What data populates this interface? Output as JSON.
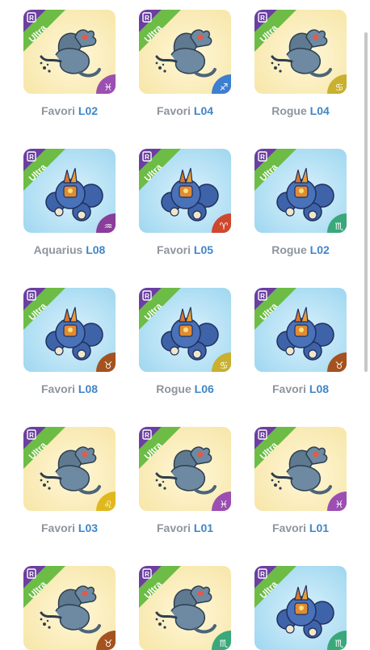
{
  "badge": "R",
  "ribbon": "Ultra",
  "colors": {
    "ribbon_green": "#6cbc46",
    "corner_purple": "#6b3fa0",
    "bg_yellow": "#f7e6a8",
    "bg_blue": "#9fd7f0",
    "label_gray": "#8d959e",
    "level_blue": "#3f86c8"
  },
  "cards": [
    {
      "name": "Favori",
      "level": "L02",
      "creature": "dragon",
      "bg": "yellow",
      "sign": "pisces-icon",
      "sign_glyph": "♓",
      "sign_color": "#9b4fb2"
    },
    {
      "name": "Favori",
      "level": "L04",
      "creature": "dragon",
      "bg": "yellow",
      "sign": "sagittarius-icon",
      "sign_glyph": "♐",
      "sign_color": "#3d7fd0"
    },
    {
      "name": "Rogue",
      "level": "L04",
      "creature": "dragon",
      "bg": "yellow",
      "sign": "cancer-icon",
      "sign_glyph": "♋",
      "sign_color": "#c9b02e"
    },
    {
      "name": "Aquarius",
      "level": "L08",
      "creature": "robot",
      "bg": "blue",
      "sign": "aquarius-icon",
      "sign_glyph": "♒",
      "sign_color": "#8a3d9a"
    },
    {
      "name": "Favori",
      "level": "L05",
      "creature": "robot",
      "bg": "blue",
      "sign": "aries-icon",
      "sign_glyph": "♈",
      "sign_color": "#d0472d"
    },
    {
      "name": "Rogue",
      "level": "L02",
      "creature": "robot",
      "bg": "blue",
      "sign": "scorpio-icon",
      "sign_glyph": "♏",
      "sign_color": "#3aa87a"
    },
    {
      "name": "Favori",
      "level": "L08",
      "creature": "robot",
      "bg": "blue",
      "sign": "taurus-icon",
      "sign_glyph": "♉",
      "sign_color": "#a4521f"
    },
    {
      "name": "Rogue",
      "level": "L06",
      "creature": "robot",
      "bg": "blue",
      "sign": "cancer-icon",
      "sign_glyph": "♋",
      "sign_color": "#c9b02e"
    },
    {
      "name": "Favori",
      "level": "L08",
      "creature": "robot",
      "bg": "blue",
      "sign": "taurus-icon",
      "sign_glyph": "♉",
      "sign_color": "#a4521f"
    },
    {
      "name": "Favori",
      "level": "L03",
      "creature": "dragon",
      "bg": "yellow",
      "sign": "leo-icon",
      "sign_glyph": "♌",
      "sign_color": "#e0b81e"
    },
    {
      "name": "Favori",
      "level": "L01",
      "creature": "dragon",
      "bg": "yellow",
      "sign": "pisces-icon",
      "sign_glyph": "♓",
      "sign_color": "#9b4fb2"
    },
    {
      "name": "Favori",
      "level": "L01",
      "creature": "dragon",
      "bg": "yellow",
      "sign": "pisces-icon",
      "sign_glyph": "♓",
      "sign_color": "#9b4fb2"
    },
    {
      "name": "",
      "level": "",
      "creature": "dragon",
      "bg": "yellow",
      "sign": "taurus-icon",
      "sign_glyph": "♉",
      "sign_color": "#a4521f"
    },
    {
      "name": "",
      "level": "",
      "creature": "dragon",
      "bg": "yellow",
      "sign": "scorpio-icon",
      "sign_glyph": "♏",
      "sign_color": "#3aa87a"
    },
    {
      "name": "",
      "level": "",
      "creature": "robot",
      "bg": "blue",
      "sign": "scorpio-icon",
      "sign_glyph": "♏",
      "sign_color": "#3aa87a"
    }
  ]
}
